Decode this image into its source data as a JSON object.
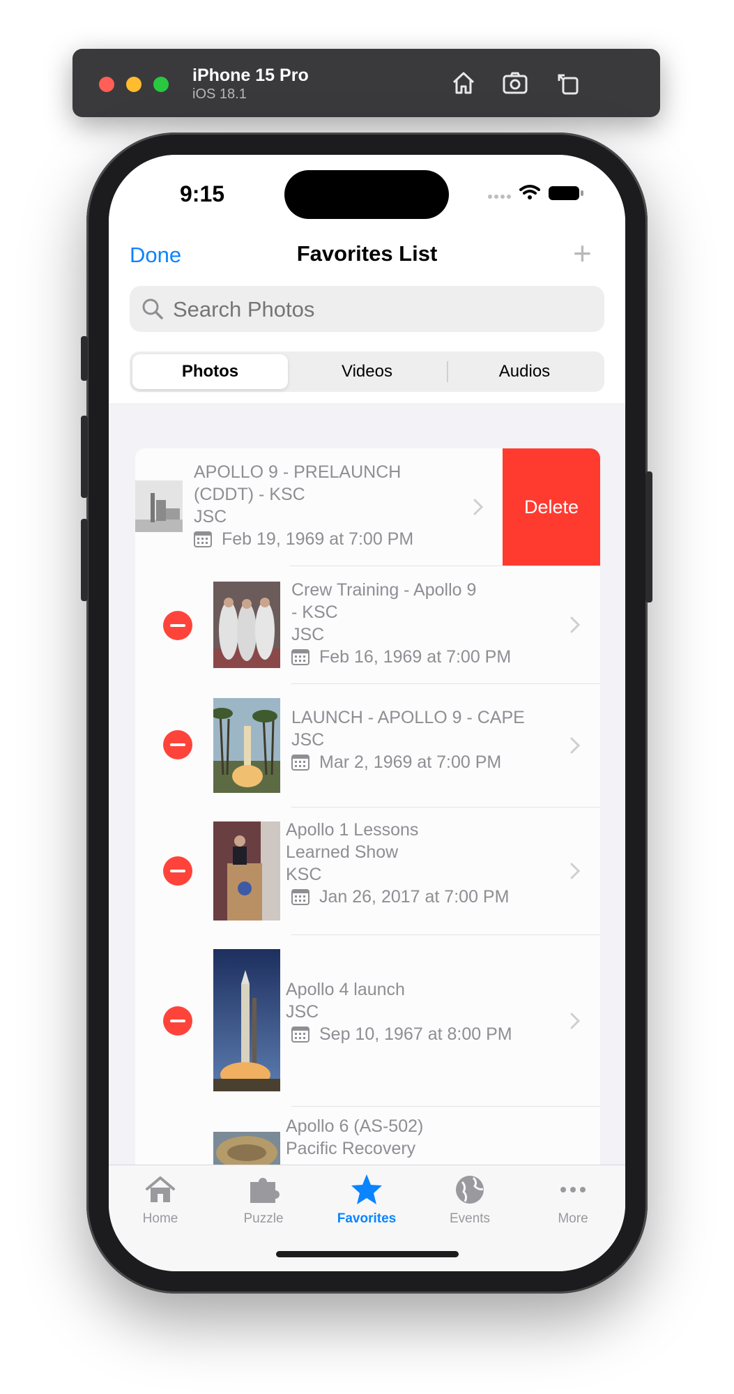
{
  "simulator": {
    "device": "iPhone 15 Pro",
    "os": "iOS 18.1",
    "icons": [
      "home-icon",
      "screenshot-icon",
      "rotate-icon"
    ]
  },
  "status_bar": {
    "time": "9:15"
  },
  "nav": {
    "done": "Done",
    "title": "Favorites List",
    "add": "+"
  },
  "search": {
    "placeholder": "Search Photos"
  },
  "segments": [
    "Photos",
    "Videos",
    "Audios"
  ],
  "selected_segment": "Photos",
  "rows": [
    {
      "title1": " APOLLO 9 - PRELAUNCH",
      "title2": "(CDDT) - KSC",
      "center": "JSC",
      "date": "Feb 19, 1969 at 7:00 PM",
      "swiped": true
    },
    {
      "title1": " Crew Training - Apollo 9",
      "title2": "- KSC",
      "center": "JSC",
      "date": "Feb 16, 1969 at 7:00 PM"
    },
    {
      "title1": " LAUNCH - APOLLO 9 - CAPE",
      "center": "JSC",
      "date": "Mar 2, 1969 at 7:00 PM"
    },
    {
      "title1": "Apollo 1 Lessons",
      "title2": "Learned Show",
      "center": "KSC",
      "date": "Jan 26, 2017 at 7:00 PM"
    },
    {
      "title1": "Apollo 4 launch",
      "center": "JSC",
      "date": "Sep 10, 1967 at 8:00 PM"
    },
    {
      "title1": "Apollo 6 (AS-502)",
      "title2": "Pacific Recovery"
    }
  ],
  "delete_label": "Delete",
  "tabs": [
    {
      "label": "Home",
      "icon": "house-icon"
    },
    {
      "label": "Puzzle",
      "icon": "puzzle-icon"
    },
    {
      "label": "Favorites",
      "icon": "star-icon",
      "active": true
    },
    {
      "label": "Events",
      "icon": "globe-icon"
    },
    {
      "label": "More",
      "icon": "ellipsis-icon"
    }
  ]
}
